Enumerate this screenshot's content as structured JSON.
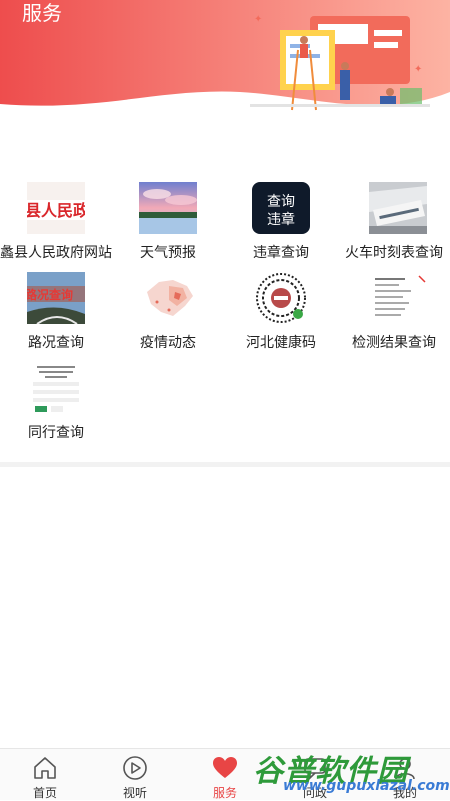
{
  "header": {
    "title": "服务"
  },
  "services": [
    {
      "label": "蠡县人民政府网站",
      "thumb_text": "县人民政",
      "icon": "government-site-icon"
    },
    {
      "label": "天气预报",
      "icon": "weather-icon"
    },
    {
      "label": "违章查询",
      "thumb_text": "查询违章",
      "icon": "traffic-violation-icon"
    },
    {
      "label": "火车时刻表查询",
      "icon": "train-icon"
    },
    {
      "label": "路况查询",
      "thumb_text": "路况查询",
      "icon": "road-condition-icon"
    },
    {
      "label": "疫情动态",
      "icon": "epidemic-map-icon"
    },
    {
      "label": "河北健康码",
      "icon": "health-qr-icon"
    },
    {
      "label": "检测结果查询",
      "icon": "test-result-icon"
    },
    {
      "label": "同行查询",
      "icon": "companion-query-icon"
    }
  ],
  "tabbar": [
    {
      "label": "首页",
      "icon": "home-icon"
    },
    {
      "label": "视听",
      "icon": "play-icon"
    },
    {
      "label": "服务",
      "icon": "heart-icon",
      "active": true
    },
    {
      "label": "问政",
      "icon": "chat-icon"
    },
    {
      "label": "我的",
      "icon": "user-icon"
    }
  ],
  "watermark": {
    "title": "谷普软件园",
    "url": "www.gupuxlazal.com"
  },
  "colors": {
    "accent": "#e84545",
    "header_start": "#ef5350",
    "header_end": "#ff8a65"
  }
}
